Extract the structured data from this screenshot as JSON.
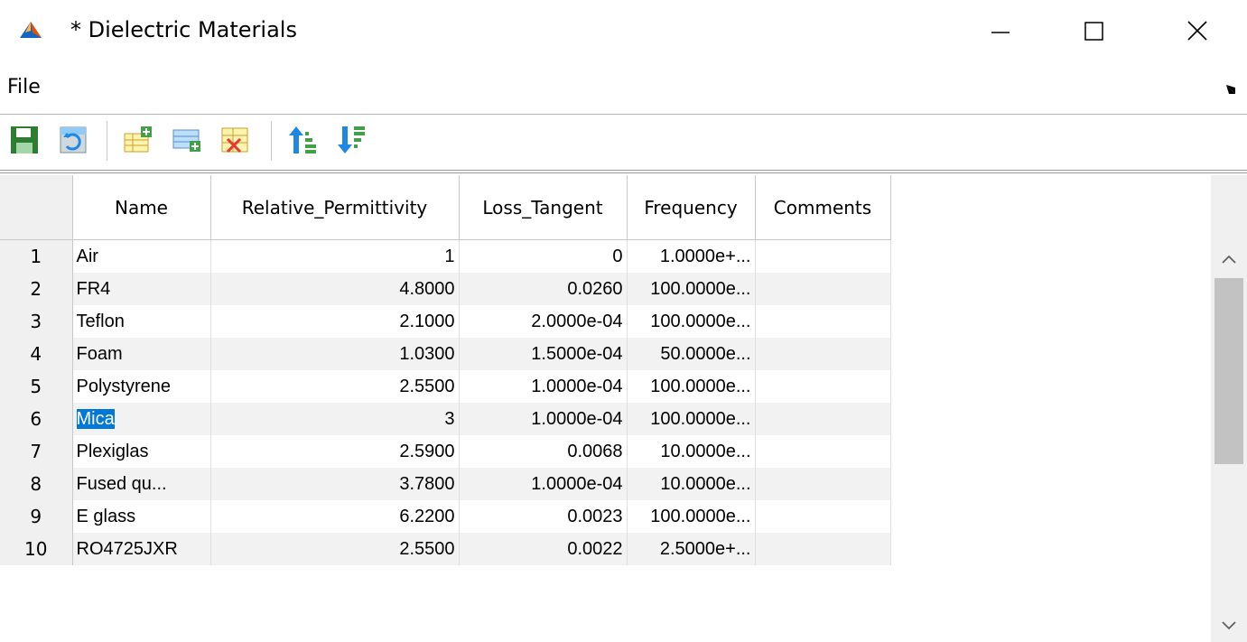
{
  "window": {
    "title": "* Dielectric Materials",
    "icon": "matlab-icon",
    "minimize_icon": "minimize-icon",
    "maximize_icon": "maximize-icon",
    "close_icon": "close-icon"
  },
  "menu": {
    "file": "File"
  },
  "toolbar": {
    "buttons": [
      "save-icon",
      "refresh-icon",
      "add-row-icon",
      "insert-row-icon",
      "delete-row-icon",
      "sort-ascending-icon",
      "sort-descending-icon"
    ]
  },
  "table": {
    "columns": [
      "Name",
      "Relative_Permittivity",
      "Loss_Tangent",
      "Frequency",
      "Comments"
    ],
    "rows": [
      {
        "n": "1",
        "name": "Air",
        "perm": "1",
        "loss": "0",
        "freq": "1.0000e+...",
        "comments": ""
      },
      {
        "n": "2",
        "name": "FR4",
        "perm": "4.8000",
        "loss": "0.0260",
        "freq": "100.0000e...",
        "comments": ""
      },
      {
        "n": "3",
        "name": "Teflon",
        "perm": "2.1000",
        "loss": "2.0000e-04",
        "freq": "100.0000e...",
        "comments": ""
      },
      {
        "n": "4",
        "name": "Foam",
        "perm": "1.0300",
        "loss": "1.5000e-04",
        "freq": "50.0000e...",
        "comments": ""
      },
      {
        "n": "5",
        "name": "Polystyrene",
        "perm": "2.5500",
        "loss": "1.0000e-04",
        "freq": "100.0000e...",
        "comments": ""
      },
      {
        "n": "6",
        "name": "Mica",
        "perm": "3",
        "loss": "1.0000e-04",
        "freq": "100.0000e...",
        "comments": ""
      },
      {
        "n": "7",
        "name": "Plexiglas",
        "perm": "2.5900",
        "loss": "0.0068",
        "freq": "10.0000e...",
        "comments": ""
      },
      {
        "n": "8",
        "name": "Fused qu...",
        "perm": "3.7800",
        "loss": "1.0000e-04",
        "freq": "10.0000e...",
        "comments": ""
      },
      {
        "n": "9",
        "name": "E glass",
        "perm": "6.2200",
        "loss": "0.0023",
        "freq": "100.0000e...",
        "comments": ""
      },
      {
        "n": "10",
        "name": "RO4725JXR",
        "perm": "2.5500",
        "loss": "0.0022",
        "freq": "2.5000e+...",
        "comments": ""
      }
    ],
    "selected_row": 6,
    "selection_color": "#0078d7"
  },
  "scrollbar": {
    "up_icon": "chevron-up-icon",
    "down_icon": "chevron-down-icon"
  }
}
